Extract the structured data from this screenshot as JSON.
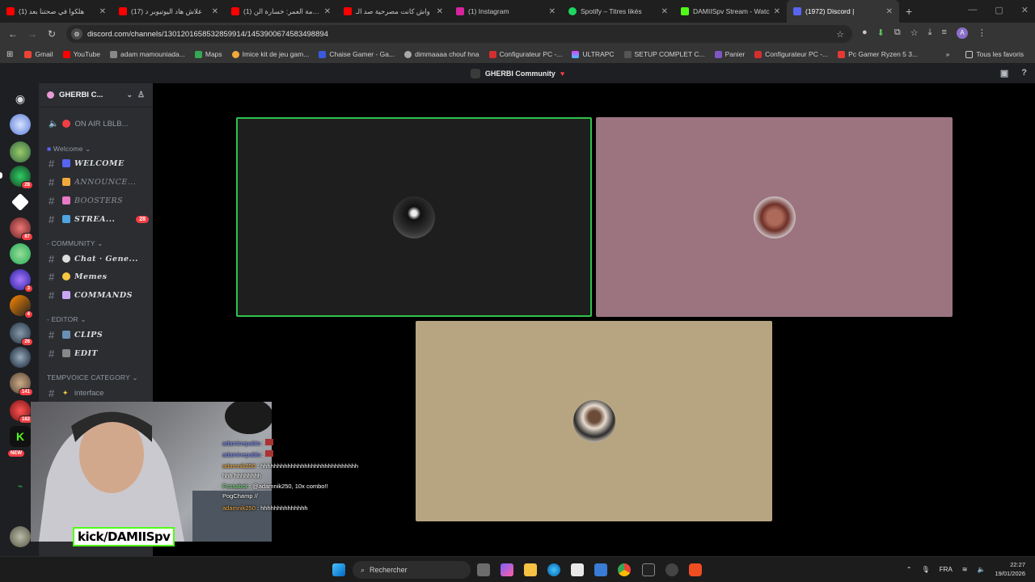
{
  "browser": {
    "tabs": [
      {
        "title": "(1) هلكوا في صحتنا بعد",
        "color": "#ff0000"
      },
      {
        "title": "(17) علاش هاد اليوتيوبر د",
        "color": "#ff0000"
      },
      {
        "title": "(1) صدمة العمر: خسارة الن",
        "color": "#ff0000"
      },
      {
        "title": "واش كانت مصرحية صد الـ",
        "color": "#ff0000"
      },
      {
        "title": "(1) Instagram",
        "color": "#d6249f"
      },
      {
        "title": "Spotify – Titres likés",
        "color": "#1ed760"
      },
      {
        "title": "DAMIISpv Stream - Watc",
        "color": "#53fc18"
      },
      {
        "title": "(1972) Discord |",
        "color": "#5865f2"
      }
    ],
    "url": "discord.com/channels/1301201658532859914/1453900674583498894",
    "bookmarks": [
      {
        "label": "Gmail",
        "color": "#ea4335"
      },
      {
        "label": "YouTube",
        "color": "#ff0000"
      },
      {
        "label": "adam mamouniada...",
        "color": "#888888"
      },
      {
        "label": "Maps",
        "color": "#34a853"
      },
      {
        "label": "Imice kit de jeu gam...",
        "color": "#f2a93b"
      },
      {
        "label": "Chaise Gamer - Ga...",
        "color": "#3b5bdb"
      },
      {
        "label": "dimmaaaa chouf hna",
        "color": "#aaaaaa"
      },
      {
        "label": "Configurateur PC -...",
        "color": "#d32f2f"
      },
      {
        "label": "ULTRAPC",
        "color": "#e040fb"
      },
      {
        "label": "SETUP COMPLET C...",
        "color": "#555555"
      },
      {
        "label": "Panier",
        "color": "#7e57c2"
      },
      {
        "label": "Configurateur PC -...",
        "color": "#d32f2f"
      },
      {
        "label": "Pc Gamer Ryzen 5 3...",
        "color": "#e53935"
      }
    ],
    "all_bookmarks": "Tous les favoris"
  },
  "discord": {
    "window_title": "GHERBI Community",
    "server_name": "GHERBI C...",
    "voice_channel": "ON AIR LBLB...",
    "categories": {
      "welcome": "Welcome",
      "community": "COMMUNITY",
      "editor": "EDITOR",
      "tempvoice": "TEMPVOICE CATEGORY"
    },
    "channels": {
      "welcome": "WELCOME",
      "announce": "ANNOUNCE...",
      "boosters": "BOOSTERS",
      "stream": "STREA...",
      "stream_badge": "28",
      "chat": "Chat · Gene...",
      "memes": "Memes",
      "commands": "COMMANDS",
      "clips": "CLIPS",
      "edit": "EDIT",
      "interface": "interface"
    },
    "guild_badges": [
      "87",
      "28",
      "3",
      "4",
      "26",
      "141",
      "182"
    ],
    "new_label": "NEW"
  },
  "stream_overlay": {
    "chat": [
      {
        "user": "adaminepablo",
        "text": ":"
      },
      {
        "user": "adaminepablo",
        "text": ":"
      },
      {
        "user": "adamnik250",
        "text": ": hhhhhhhhhhhhhhhhhhhhhhhhhhhhhhhh hhhhhhhh"
      },
      {
        "user": "Fossabot",
        "text": ": @adamnik250, 10x combo!! PogChamp //"
      },
      {
        "user": "adamnik250",
        "text": ": hhhhhhhhhhhhhh"
      }
    ],
    "kick_label": "kick/DAMIISpv"
  },
  "taskbar": {
    "search": "Rechercher",
    "lang": "FRA",
    "time": "22:27",
    "date": "19/01/2026"
  }
}
